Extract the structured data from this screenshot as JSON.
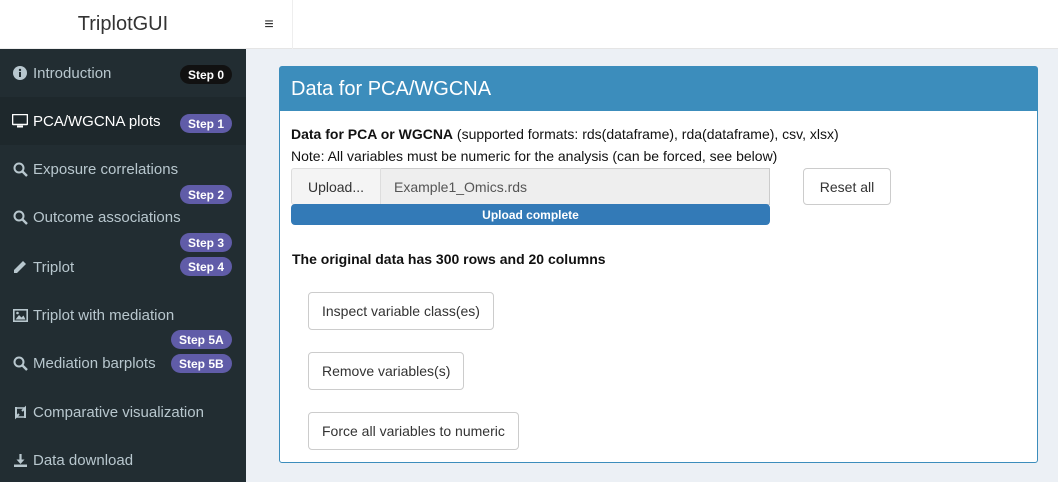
{
  "app_title": "TriplotGUI",
  "toggle_glyph": "≡",
  "sidebar": {
    "items": [
      {
        "label": "Introduction",
        "icon": "info-circle-icon",
        "badge": "Step 0"
      },
      {
        "label": "PCA/WGCNA plots",
        "icon": "monitor-icon",
        "badge": "Step 1"
      },
      {
        "label": "Exposure correlations",
        "icon": "search-icon",
        "badge": "Step 2"
      },
      {
        "label": "Outcome associations",
        "icon": "search-icon",
        "badge": "Step 3"
      },
      {
        "label": "Triplot",
        "icon": "pencil-icon",
        "badge": "Step 4"
      },
      {
        "label": "Triplot with mediation",
        "icon": "image-icon",
        "badge": "Step 5A"
      },
      {
        "label": "Mediation barplots",
        "icon": "search-icon",
        "badge": "Step 5B"
      },
      {
        "label": "Comparative visualization",
        "icon": "refresh-icon"
      },
      {
        "label": "Data download",
        "icon": "download-icon"
      }
    ]
  },
  "box": {
    "title": "Data for PCA/WGCNA",
    "input_label_bold": "Data for PCA or WGCNA",
    "input_label_rest": " (supported formats: rds(dataframe), rda(dataframe), csv, xlsx)",
    "note": "Note: All variables must be numeric for the analysis (can be forced, see below)",
    "upload_button": "Upload...",
    "file_name": "Example1_Omics.rds",
    "upload_status": "Upload complete",
    "upload_progress": 1.0,
    "reset_button": "Reset all",
    "summary": "The original data has 300 rows and 20 columns",
    "inspect_button": "Inspect variable class(es)",
    "remove_button": "Remove variables(s)",
    "force_button": "Force all variables to numeric"
  },
  "colors": {
    "sidebar_bg": "#222d32",
    "header_blue": "#3c8dbc",
    "progress_blue": "#337ab7",
    "badge_purple": "#605ca8",
    "badge_black": "#111111"
  }
}
